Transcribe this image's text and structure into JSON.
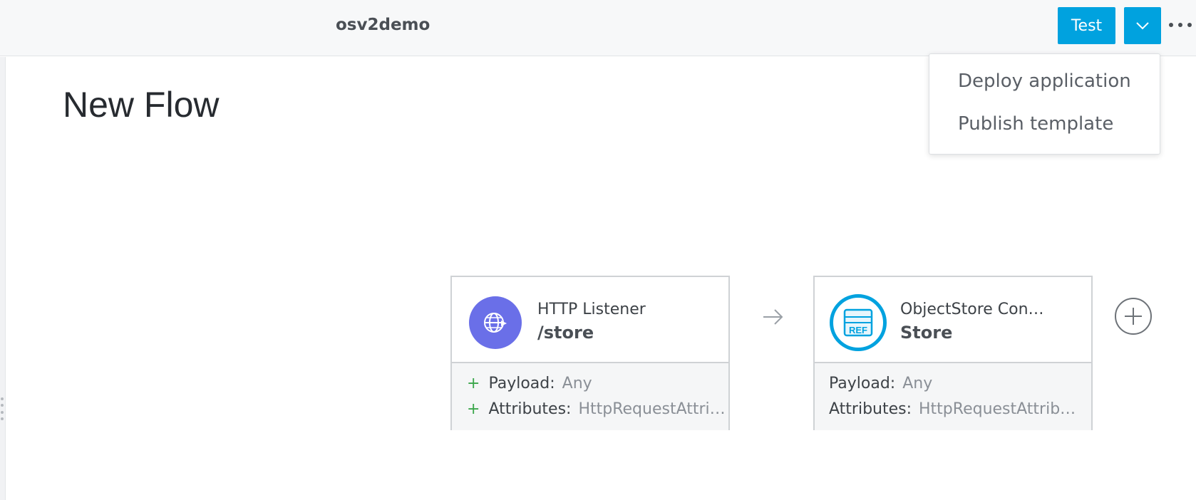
{
  "header": {
    "app_name": "osv2demo",
    "test_button": "Test",
    "chevron_icon": "chevron-down-icon",
    "more_icon": "more-horizontal-icon"
  },
  "dropdown": {
    "items": [
      {
        "label": "Deploy application"
      },
      {
        "label": "Publish template"
      }
    ]
  },
  "flow": {
    "title": "New Flow",
    "components": [
      {
        "subtitle": "HTTP Listener",
        "title": "/store",
        "icon": "globe-icon",
        "rows": [
          {
            "plus": "+",
            "label": "Payload:",
            "value": "Any"
          },
          {
            "plus": "+",
            "label": "Attributes:",
            "value": "HttpRequestAttri…"
          }
        ]
      },
      {
        "subtitle": "ObjectStore Con…",
        "title": "Store",
        "icon": "ref-icon",
        "icon_text": "REF",
        "rows": [
          {
            "label": "Payload:",
            "value": "Any"
          },
          {
            "label": "Attributes:",
            "value": "HttpRequestAttrib…"
          }
        ]
      }
    ],
    "connector_icon": "arrow-right-icon",
    "add_icon": "plus-circle-icon"
  },
  "colors": {
    "accent": "#00a2df",
    "http_icon_bg": "#6a6fe8",
    "plus_green": "#3aa64a"
  }
}
